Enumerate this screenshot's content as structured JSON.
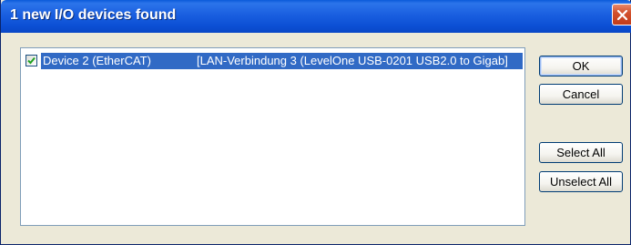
{
  "window": {
    "title": "1 new I/O devices found",
    "close_icon": "close-icon"
  },
  "devices": [
    {
      "checked": true,
      "name": "Device 2 (EtherCAT)",
      "detail": "[LAN-Verbindung 3 (LevelOne USB-0201 USB2.0 to Gigab]"
    }
  ],
  "buttons": {
    "ok": "OK",
    "cancel": "Cancel",
    "select_all": "Select All",
    "unselect_all": "Unselect All"
  },
  "colors": {
    "titlebar": "#0b4fd4",
    "selection": "#316ac5",
    "close_button": "#c33b18",
    "dialog_face": "#ece9d8"
  }
}
